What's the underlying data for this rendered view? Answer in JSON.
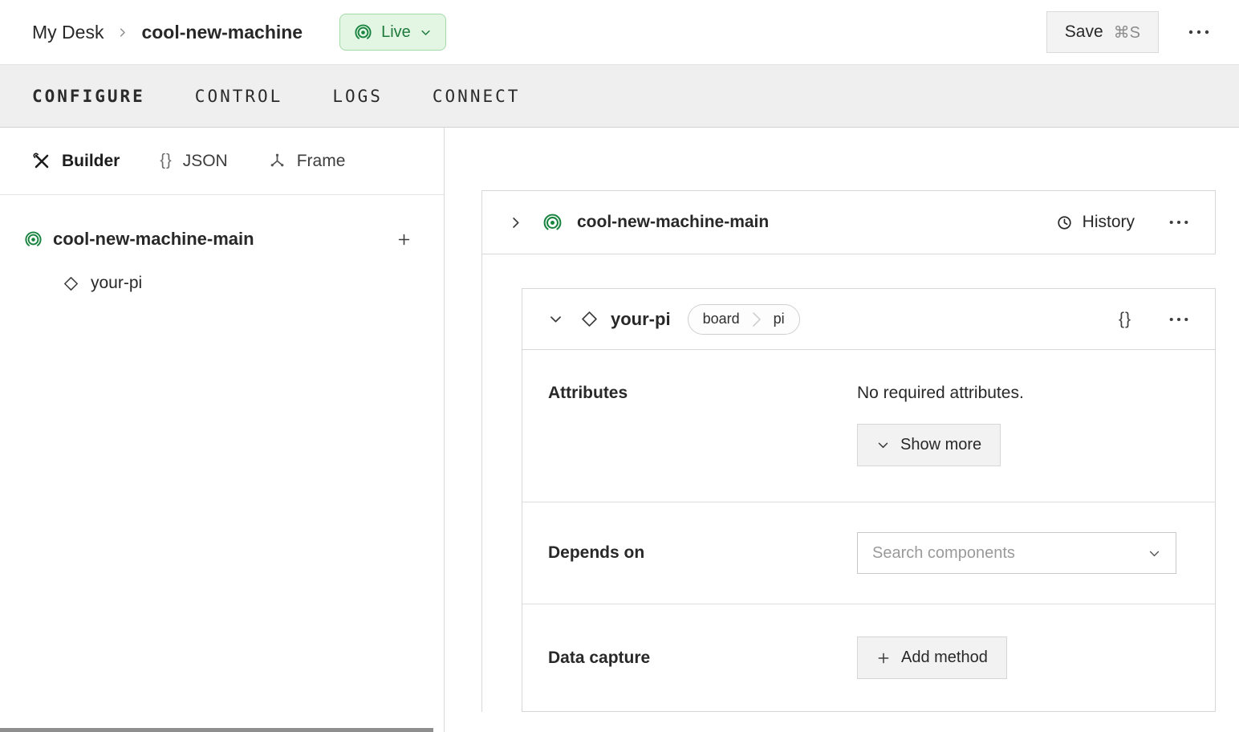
{
  "header": {
    "breadcrumb": {
      "root": "My Desk",
      "current": "cool-new-machine"
    },
    "live": {
      "label": "Live"
    },
    "save": {
      "label": "Save",
      "shortcut": "⌘S"
    }
  },
  "tabs": [
    {
      "label": "CONFIGURE",
      "active": true
    },
    {
      "label": "CONTROL",
      "active": false
    },
    {
      "label": "LOGS",
      "active": false
    },
    {
      "label": "CONNECT",
      "active": false
    }
  ],
  "sidebar": {
    "modes": [
      {
        "label": "Builder",
        "active": true
      },
      {
        "label": "JSON",
        "active": false
      },
      {
        "label": "Frame",
        "active": false
      }
    ],
    "tree": {
      "machine_label": "cool-new-machine-main",
      "children": [
        {
          "label": "your-pi"
        }
      ]
    }
  },
  "main": {
    "part_card": {
      "title": "cool-new-machine-main",
      "history_label": "History"
    },
    "component_card": {
      "title": "your-pi",
      "tags": [
        {
          "label": "board"
        },
        {
          "label": "pi"
        }
      ],
      "attributes": {
        "label": "Attributes",
        "empty_text": "No required attributes.",
        "show_more_label": "Show more"
      },
      "depends_on": {
        "label": "Depends on",
        "search_placeholder": "Search components"
      },
      "data_capture": {
        "label": "Data capture",
        "add_method_label": "Add method"
      }
    }
  },
  "icons": {
    "braces": "{}"
  },
  "colors": {
    "accent_green": "#19843f",
    "live_badge_bg": "#e3f5e3",
    "live_badge_border": "#a5d9a8",
    "tabbar_bg": "#efefef",
    "button_bg": "#f2f2f2",
    "border": "#d7d7d7"
  }
}
